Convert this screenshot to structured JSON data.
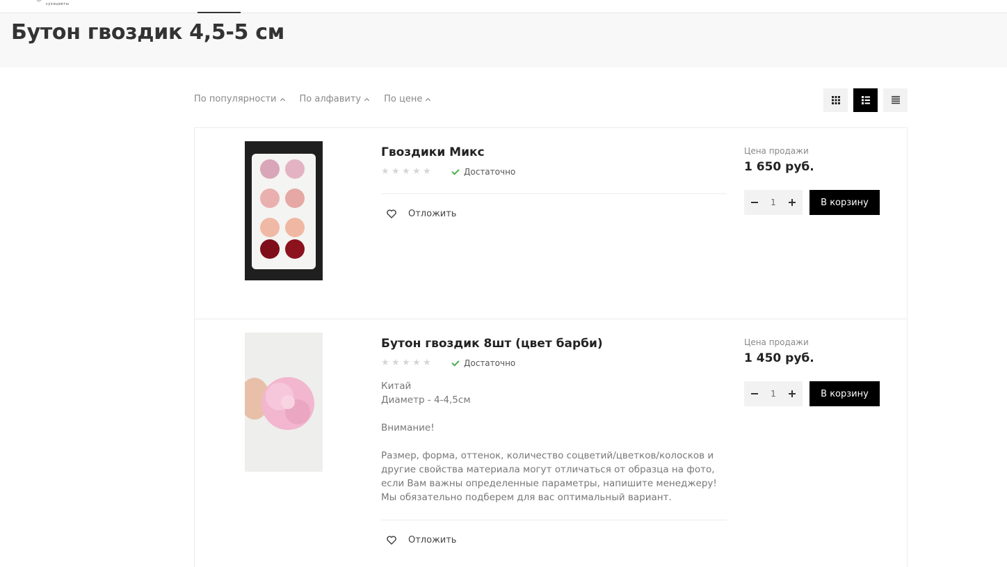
{
  "header": {
    "logo_caption": "сухоцветы"
  },
  "page": {
    "title": "Бутон гвоздик 4,5-5 см"
  },
  "sort": {
    "items": [
      {
        "label": "По популярности"
      },
      {
        "label": "По алфавиту"
      },
      {
        "label": "По цене"
      }
    ]
  },
  "view_modes": [
    {
      "icon": "grid-view-icon",
      "active": false
    },
    {
      "icon": "list-view-icon",
      "active": true
    },
    {
      "icon": "table-view-icon",
      "active": false
    }
  ],
  "products": [
    {
      "name": "Гвоздики Микс",
      "rating": 0,
      "stock": "Достаточно",
      "description": [],
      "defer_label": "Отложить",
      "price_label": "Цена продажи",
      "price": "1 650 руб.",
      "quantity": "1",
      "cart_label": "В корзину"
    },
    {
      "name": "Бутон гвоздик 8шт (цвет барби)",
      "rating": 0,
      "stock": "Достаточно",
      "description": [
        "Китай",
        "Диаметр - 4-4,5см",
        "",
        "Внимание!",
        "",
        "Размер, форма, оттенок, количество соцветий/цветков/колосков и другие свойства материала могут отличаться от образца на фото, если Вам важны определенные параметры, напишите менеджеру! Мы обязательно подберем для вас оптимальный вариант."
      ],
      "defer_label": "Отложить",
      "price_label": "Цена продажи",
      "price": "1 450 руб.",
      "quantity": "1",
      "cart_label": "В корзину"
    }
  ],
  "colors": {
    "accent": "#000000",
    "stock_check": "#4caf50",
    "title_band": "#f8f8f8"
  }
}
